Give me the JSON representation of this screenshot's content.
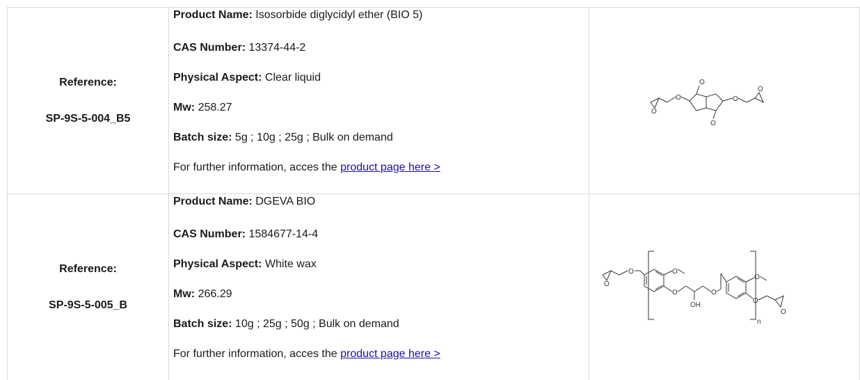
{
  "products": [
    {
      "reference_label": "Reference:",
      "reference_code": "SP-9S-5-004_B5",
      "name_label": "Product Name:",
      "name_value": "Isosorbide diglycidyl ether (BIO 5)",
      "cas_label": "CAS Number:",
      "cas_value": "13374-44-2",
      "aspect_label": "Physical Aspect:",
      "aspect_value": "Clear liquid",
      "mw_label": "Mw:",
      "mw_value": "258.27",
      "batch_label": "Batch size:",
      "batch_value": "5g ; 10g ; 25g ; Bulk on demand",
      "info_text": "For further information, acces the",
      "link_text": "product page here >"
    },
    {
      "reference_label": "Reference:",
      "reference_code": "SP-9S-5-005_B",
      "name_label": "Product Name:",
      "name_value": "DGEVA BIO",
      "cas_label": "CAS Number:",
      "cas_value": "1584677-14-4",
      "aspect_label": "Physical Aspect:",
      "aspect_value": "White wax",
      "mw_label": "Mw:",
      "mw_value": "266.29",
      "batch_label": "Batch size:",
      "batch_value": "10g ; 25g ; 50g ; Bulk on demand",
      "info_text": "For further information, acces the",
      "link_text": "product page here >"
    }
  ],
  "structure_labels": {
    "oxygen": "O",
    "hydroxyl": "OH",
    "repeat": "n"
  }
}
